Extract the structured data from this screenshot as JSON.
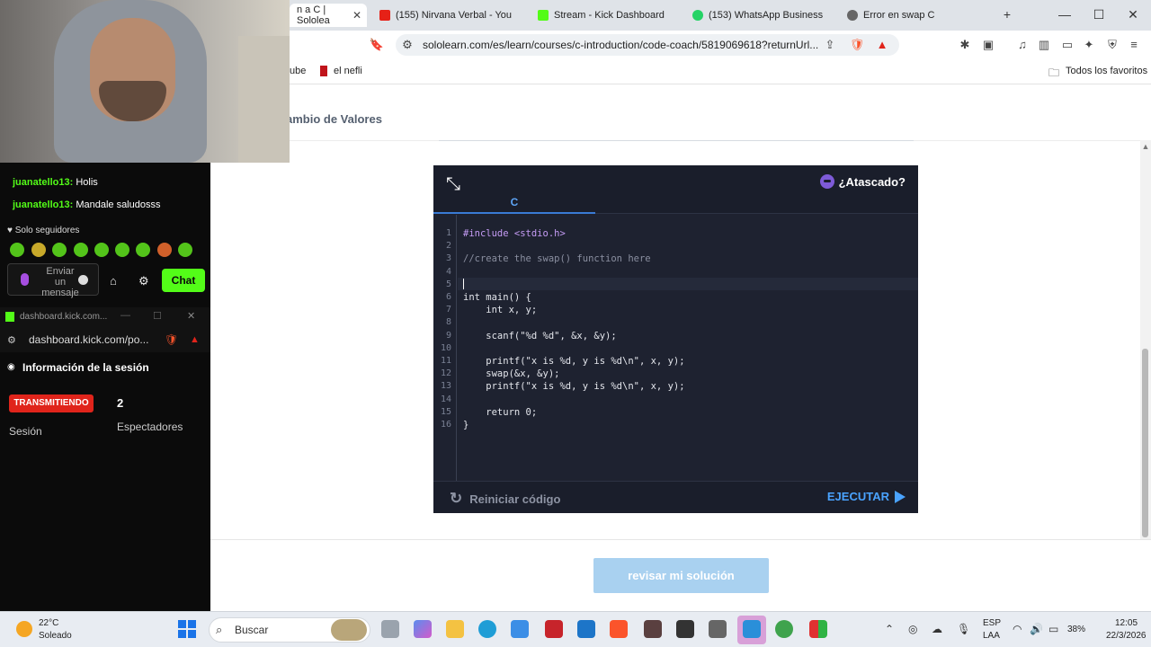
{
  "browser": {
    "tabs": [
      {
        "label": "n a C | Sololea",
        "active": true
      },
      {
        "label": "(155) Nirvana Verbal - You",
        "active": false
      },
      {
        "label": "Stream - Kick Dashboard",
        "active": false
      },
      {
        "label": "(153) WhatsApp Business",
        "active": false
      },
      {
        "label": "Error en swap C",
        "active": false
      }
    ],
    "new_tab": "+",
    "url": "sololearn.com/es/learn/courses/c-introduction/code-coach/5819069618?returnUrl...",
    "bookmarks": [
      "ube",
      "el nefli"
    ],
    "all_favorites": "Todos los favoritos"
  },
  "page": {
    "title": "ambio de Valores",
    "editor": {
      "stuck_label": "¿Atascado?",
      "language_tab": "C",
      "line_numbers": [
        "1",
        "2",
        "3",
        "4",
        "5",
        "6",
        "7",
        "8",
        "9",
        "10",
        "11",
        "12",
        "13",
        "14",
        "15",
        "16"
      ],
      "code_lines": [
        "#include <stdio.h>",
        "",
        "//create the swap() function here",
        "",
        "",
        "int main() {",
        "    int x, y;",
        "",
        "    scanf(\"%d %d\", &x, &y);",
        "",
        "    printf(\"x is %d, y is %d\\n\", x, y);",
        "    swap(&x, &y);",
        "    printf(\"x is %d, y is %d\\n\", x, y);",
        "",
        "    return 0;",
        "}"
      ],
      "reset_label": "Reiniciar código",
      "run_label": "EJECUTAR"
    },
    "check_button": "revisar mi solución"
  },
  "stream_panel": {
    "chat": [
      {
        "user": "juanatello13:",
        "text": "Holis"
      },
      {
        "user": "juanatello13:",
        "text": "Mandale saludosss"
      }
    ],
    "followers_only": "Solo seguidores",
    "message_placeholder": "Enviar un mensaje",
    "chat_button": "Chat",
    "dashboard_window_title": "dashboard.kick.com...",
    "dashboard_url": "dashboard.kick.com/po...",
    "session_header": "Información de la sesión",
    "live_badge": "TRANSMITIENDO",
    "session_label": "Sesión",
    "viewers_count": "2",
    "viewers_label": "Espectadores"
  },
  "taskbar": {
    "temperature": "22°C",
    "weather": "Soleado",
    "search_placeholder": "Buscar",
    "lang_top": "ESP",
    "lang_bottom": "LAA",
    "battery": "38%",
    "time": "12:05",
    "date": "22/3/2026"
  },
  "colors": {
    "editor_bg": "#1e2230",
    "kick_green": "#53fc18",
    "run_blue": "#4aa3ff",
    "live_red": "#e0241b"
  }
}
